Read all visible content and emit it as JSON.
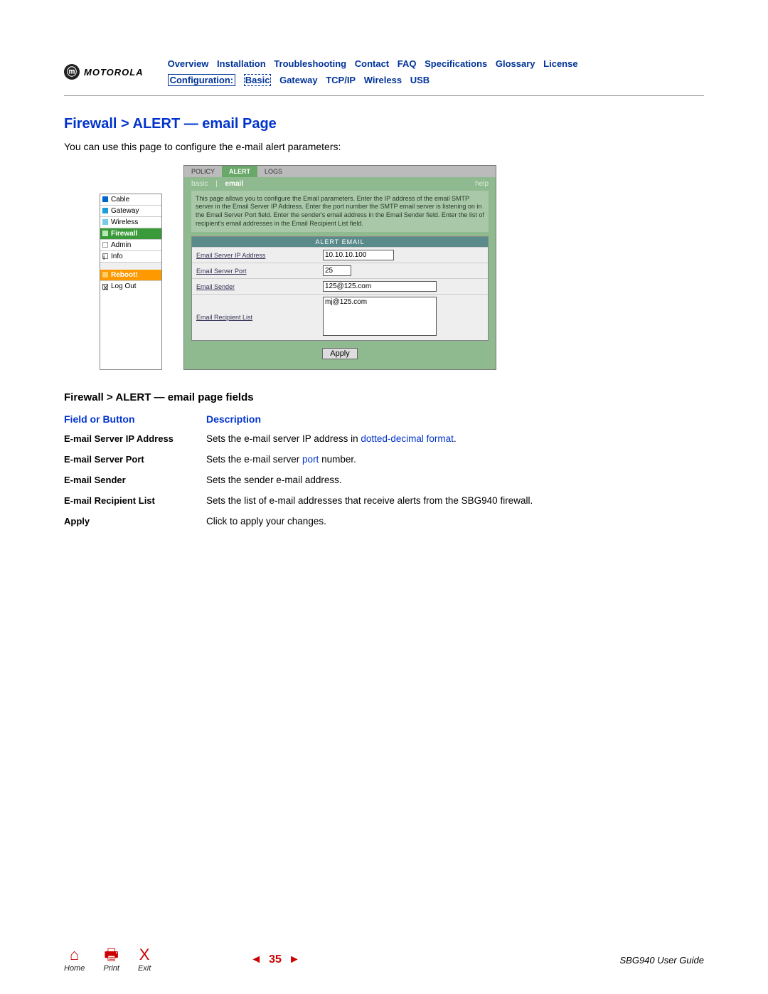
{
  "logo_text": "MOTOROLA",
  "nav": {
    "line1": [
      "Overview",
      "Installation",
      "Troubleshooting",
      "Contact",
      "FAQ",
      "Specifications",
      "Glossary",
      "License"
    ],
    "config_label": "Configuration:",
    "line2": [
      "Basic",
      "Gateway",
      "TCP/IP",
      "Wireless",
      "USB"
    ]
  },
  "page_title": "Firewall > ALERT — email Page",
  "intro": "You can use this page to configure the e-mail alert parameters:",
  "sidebar_items": {
    "cable": "Cable",
    "gateway": "Gateway",
    "wireless": "Wireless",
    "firewall": "Firewall",
    "admin": "Admin",
    "info": "Info",
    "reboot": "Reboot!",
    "logout": "Log Out"
  },
  "screenshot": {
    "tabs": {
      "policy": "POLICY",
      "alert": "ALERT",
      "logs": "LOGS"
    },
    "subtabs": {
      "basic": "basic",
      "email": "email",
      "help": "help"
    },
    "desc": "This page allows you to configure the Email parameters. Enter the IP address of the email SMTP server in the Email Server IP Address. Enter the port number the SMTP email server is listening on in the Email Server Port field. Enter the sender's email address in the Email Sender field. Enter the list of recipient's email addresses in the Email Recipient List field.",
    "form_header": "ALERT EMAIL",
    "labels": {
      "ip": "Email Server IP Address",
      "port": "Email Server Port",
      "sender": "Email Sender",
      "recip": "Email Recipient List"
    },
    "values": {
      "ip": "10.10.10.100",
      "port": "25",
      "sender": "125@125.com",
      "recip": "mj@125.com"
    },
    "apply": "Apply"
  },
  "section_title": "Firewall > ALERT — email page fields",
  "table": {
    "head": {
      "c1": "Field or Button",
      "c2": "Description"
    },
    "rows": [
      {
        "c1": "E-mail Server IP Address",
        "c2_pre": "Sets the e-mail server IP address in ",
        "c2_link": "dotted-decimal format",
        "c2_post": "."
      },
      {
        "c1": "E-mail Server Port",
        "c2_pre": "Sets the e-mail server ",
        "c2_link": "port",
        "c2_post": " number."
      },
      {
        "c1": "E-mail Sender",
        "c2_pre": "Sets the sender e-mail address.",
        "c2_link": "",
        "c2_post": ""
      },
      {
        "c1": "E-mail Recipient List",
        "c2_pre": "Sets the list of e-mail addresses that receive alerts from the SBG940 firewall.",
        "c2_link": "",
        "c2_post": ""
      },
      {
        "c1": "Apply",
        "c2_pre": "Click to apply your changes.",
        "c2_link": "",
        "c2_post": ""
      }
    ]
  },
  "footer": {
    "home": "Home",
    "print": "Print",
    "exit": "Exit",
    "page": "35",
    "guide": "SBG940 User Guide"
  }
}
